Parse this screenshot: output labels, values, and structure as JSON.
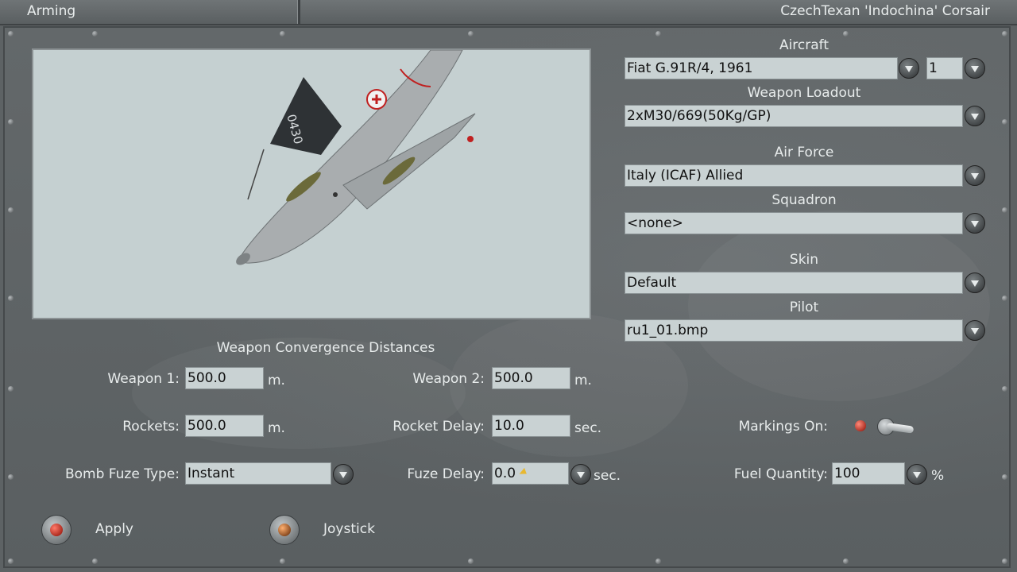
{
  "window": {
    "title_left": "Arming",
    "title_right": "CzechTexan 'Indochina' Corsair"
  },
  "aircraft_section": {
    "aircraft_label": "Aircraft",
    "aircraft_value": "Fiat G.91R/4, 1961",
    "count_value": "1",
    "loadout_label": "Weapon Loadout",
    "loadout_value": "2xM30/669(50Kg/GP)",
    "airforce_label": "Air Force",
    "airforce_value": "Italy (ICAF) Allied",
    "squadron_label": "Squadron",
    "squadron_value": "<none>",
    "skin_label": "Skin",
    "skin_value": "Default",
    "pilot_label": "Pilot",
    "pilot_value": "ru1_01.bmp"
  },
  "preview": {
    "tail_code": "0430"
  },
  "convergence": {
    "heading": "Weapon Convergence Distances",
    "weapon1_label": "Weapon 1:",
    "weapon1_value": "500.0",
    "weapon1_unit": "m.",
    "weapon2_label": "Weapon 2:",
    "weapon2_value": "500.0",
    "weapon2_unit": "m.",
    "rockets_label": "Rockets:",
    "rockets_value": "500.0",
    "rockets_unit": "m.",
    "rocket_delay_label": "Rocket Delay:",
    "rocket_delay_value": "10.0",
    "rocket_delay_unit": "sec.",
    "bomb_fuze_label": "Bomb Fuze Type:",
    "bomb_fuze_value": "Instant",
    "fuze_delay_label": "Fuze Delay:",
    "fuze_delay_value": "0.0",
    "fuze_delay_unit": "sec."
  },
  "options": {
    "markings_label": "Markings On:",
    "fuel_label": "Fuel Quantity:",
    "fuel_value": "100",
    "fuel_unit": "%"
  },
  "buttons": {
    "apply_label": "Apply",
    "joystick_label": "Joystick"
  },
  "icons": {
    "dropdown": "chevron-down-icon",
    "knob": "round-knob-icon"
  }
}
